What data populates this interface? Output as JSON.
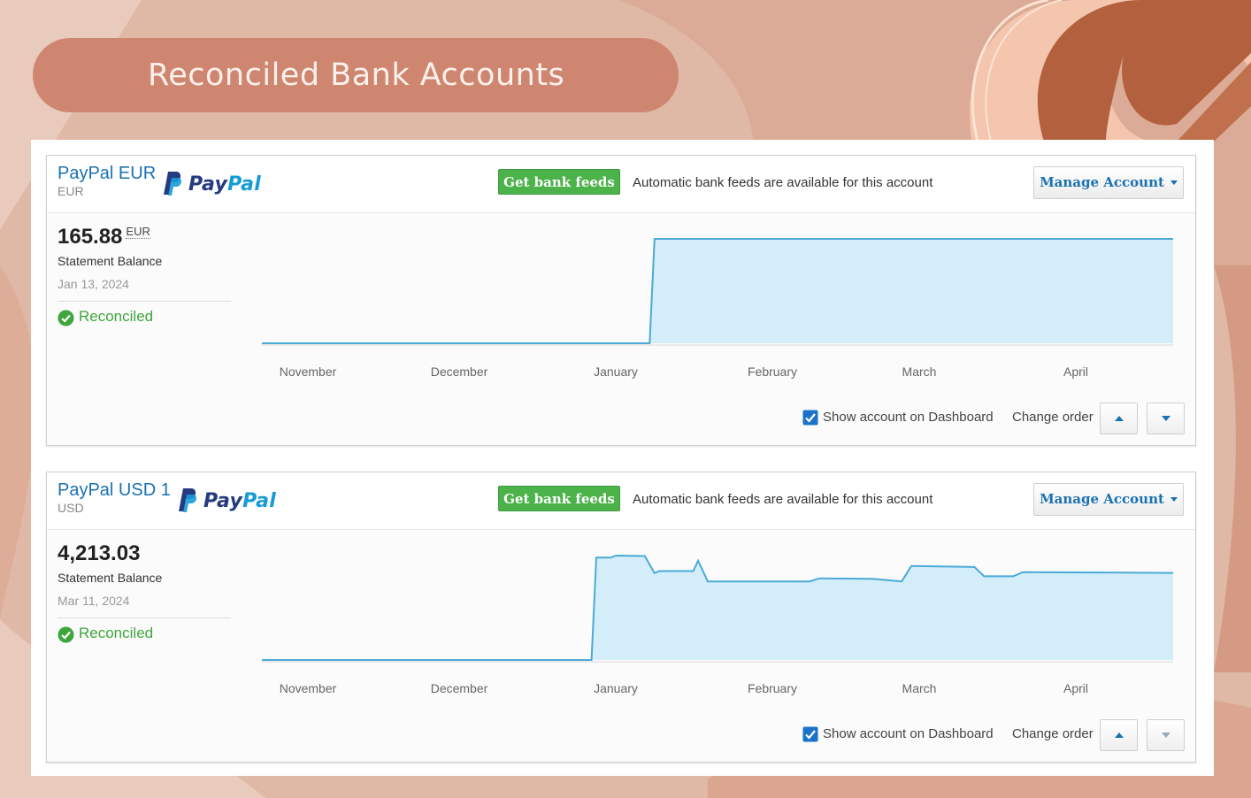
{
  "page": {
    "title": "Reconciled Bank Accounts",
    "colors": {
      "accent_pill": "#cf8670",
      "link_blue": "#1a71b2",
      "feed_green": "#4cb24a",
      "reconciled_green": "#3ea63c",
      "chart_fill": "#d4eef9",
      "chart_line": "#4aaad8"
    }
  },
  "accounts": [
    {
      "name": "PayPal EUR",
      "currency": "EUR",
      "logo": {
        "pay": "Pay",
        "pal": "Pal",
        "icon": "paypal-p-icon"
      },
      "feed_button": "Get bank feeds",
      "feed_note": "Automatic bank feeds are available for this account",
      "manage_button": "Manage Account",
      "balance": "165.88",
      "balance_currency": "EUR",
      "statement_label": "Statement Balance",
      "statement_date": "Jan 13, 2024",
      "status": "Reconciled",
      "show_on_dashboard": "Show account on Dashboard",
      "show_on_dashboard_checked": true,
      "change_order": "Change order"
    },
    {
      "name": "PayPal USD 1",
      "currency": "USD",
      "logo": {
        "pay": "Pay",
        "pal": "Pal",
        "icon": "paypal-p-icon"
      },
      "feed_button": "Get bank feeds",
      "feed_note": "Automatic bank feeds are available for this account",
      "manage_button": "Manage Account",
      "balance": "4,213.03",
      "balance_currency": "",
      "statement_label": "Statement Balance",
      "statement_date": "Mar 11, 2024",
      "status": "Reconciled",
      "show_on_dashboard": "Show account on Dashboard",
      "show_on_dashboard_checked": true,
      "change_order": "Change order"
    }
  ],
  "chart_data": [
    {
      "type": "area",
      "x_labels": [
        "November",
        "December",
        "January",
        "February",
        "March",
        "April"
      ],
      "series": [
        {
          "values": [
            [
              "2023-10-25",
              0
            ],
            [
              "2024-01-13",
              0
            ],
            [
              "2024-01-14",
              165.88
            ],
            [
              "2024-04-30",
              165.88
            ]
          ]
        }
      ],
      "x_range": [
        "2023-10-25",
        "2024-04-30"
      ],
      "y_range": [
        0,
        165.88
      ],
      "grid": false
    },
    {
      "type": "area",
      "x_labels": [
        "November",
        "December",
        "January",
        "February",
        "March",
        "April"
      ],
      "series": [
        {
          "values": [
            [
              "2023-10-25",
              0
            ],
            [
              "2024-01-01",
              0
            ],
            [
              "2024-01-02",
              4950
            ],
            [
              "2024-01-05",
              4950
            ],
            [
              "2024-01-06",
              5050
            ],
            [
              "2024-01-12",
              5030
            ],
            [
              "2024-01-14",
              4200
            ],
            [
              "2024-01-15",
              4300
            ],
            [
              "2024-01-22",
              4300
            ],
            [
              "2024-01-23",
              4800
            ],
            [
              "2024-01-25",
              3800
            ],
            [
              "2024-02-15",
              3800
            ],
            [
              "2024-02-17",
              3950
            ],
            [
              "2024-02-28",
              3930
            ],
            [
              "2024-03-05",
              3800
            ],
            [
              "2024-03-07",
              4550
            ],
            [
              "2024-03-20",
              4500
            ],
            [
              "2024-03-22",
              4050
            ],
            [
              "2024-03-28",
              4050
            ],
            [
              "2024-03-30",
              4250
            ],
            [
              "2024-04-30",
              4213.03
            ]
          ]
        }
      ],
      "x_range": [
        "2023-10-25",
        "2024-04-30"
      ],
      "y_range": [
        0,
        5050
      ],
      "grid": false
    }
  ]
}
